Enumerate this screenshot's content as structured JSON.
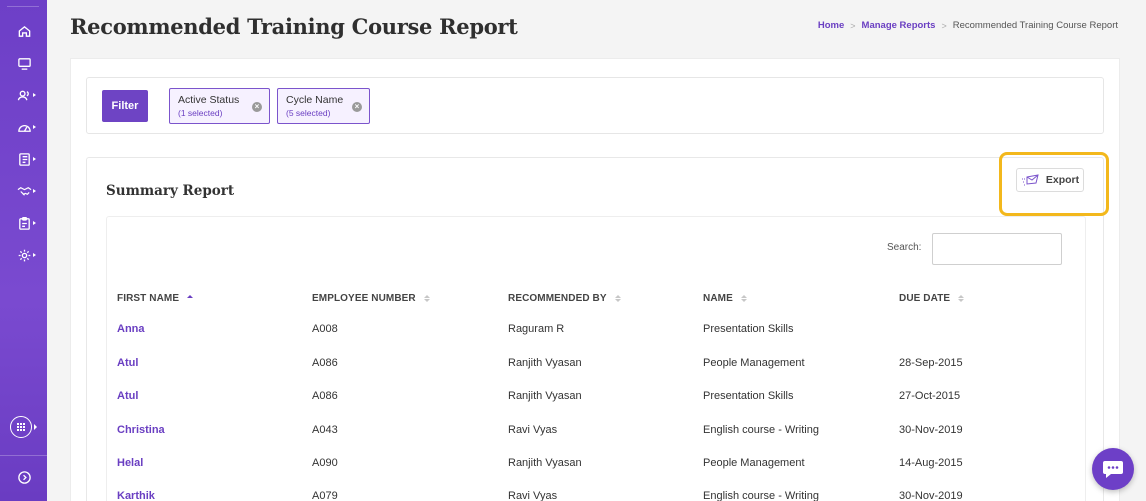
{
  "page": {
    "title": "Recommended Training Course Report"
  },
  "breadcrumb": {
    "home": "Home",
    "manage": "Manage Reports",
    "current": "Recommended Training Course Report"
  },
  "sidebar": {
    "items": [
      {
        "icon": "home-icon",
        "has_submenu": false
      },
      {
        "icon": "monitor-icon",
        "has_submenu": false
      },
      {
        "icon": "users-icon",
        "has_submenu": true
      },
      {
        "icon": "gauge-icon",
        "has_submenu": true
      },
      {
        "icon": "book-icon",
        "has_submenu": true
      },
      {
        "icon": "handshake-icon",
        "has_submenu": true
      },
      {
        "icon": "clipboard-icon",
        "has_submenu": true
      },
      {
        "icon": "settings-icon",
        "has_submenu": true
      }
    ],
    "apps_icon": "grid-icon",
    "expand_icon": "chevron-right-icon"
  },
  "filters": {
    "button_label": "Filter",
    "chips": [
      {
        "label": "Active Status",
        "sub": "(1 selected)"
      },
      {
        "label": "Cycle Name",
        "sub": "(5 selected)"
      }
    ]
  },
  "summary": {
    "title": "Summary Report",
    "export_label": "Export",
    "search_label": "Search:",
    "search_value": ""
  },
  "table": {
    "columns": [
      "FIRST NAME",
      "EMPLOYEE NUMBER",
      "RECOMMENDED BY",
      "NAME",
      "DUE DATE"
    ],
    "sorted_column": "FIRST NAME",
    "rows": [
      {
        "first": "Anna",
        "emp": "A008",
        "by": "Raguram R",
        "name": "Presentation Skills",
        "due": ""
      },
      {
        "first": "Atul",
        "emp": "A086",
        "by": "Ranjith Vyasan",
        "name": "People Management",
        "due": "28-Sep-2015"
      },
      {
        "first": "Atul",
        "emp": "A086",
        "by": "Ranjith Vyasan",
        "name": "Presentation Skills",
        "due": "27-Oct-2015"
      },
      {
        "first": "Christina",
        "emp": "A043",
        "by": "Ravi Vyas",
        "name": "English course - Writing",
        "due": "30-Nov-2019"
      },
      {
        "first": "Helal",
        "emp": "A090",
        "by": "Ranjith Vyasan",
        "name": "People Management",
        "due": "14-Aug-2015"
      },
      {
        "first": "Karthik",
        "emp": "A079",
        "by": "Ravi Vyas",
        "name": "English course - Writing",
        "due": "30-Nov-2019"
      }
    ]
  },
  "colors": {
    "accent": "#6e44c4",
    "highlight": "#f3b81c"
  }
}
